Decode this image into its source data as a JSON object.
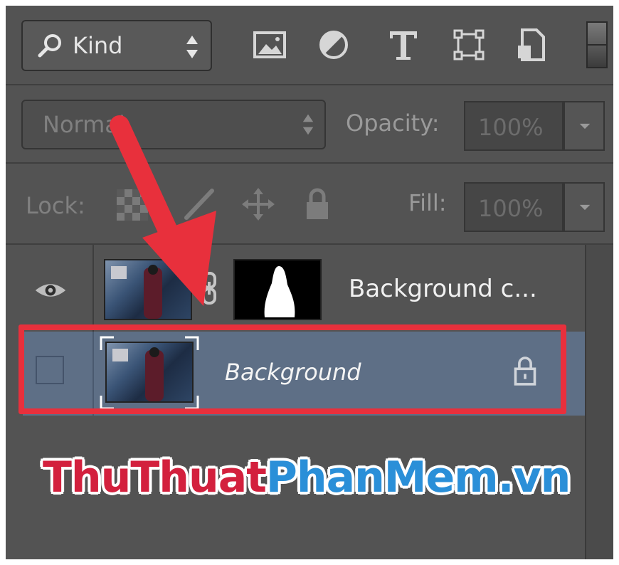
{
  "filter": {
    "kind_label": "Kind",
    "icons": [
      "image-filter-icon",
      "adjustment-filter-icon",
      "type-filter-icon",
      "shape-filter-icon",
      "smart-object-filter-icon",
      "filter-toggle-icon"
    ]
  },
  "blend": {
    "mode": "Normal",
    "opacity_label": "Opacity:",
    "opacity_value": "100%"
  },
  "lock": {
    "label": "Lock:",
    "fill_label": "Fill:",
    "fill_value": "100%"
  },
  "layers": [
    {
      "name": "Background c...",
      "visible": true,
      "has_mask": true,
      "locked": false,
      "selected": false
    },
    {
      "name": "Background",
      "visible": false,
      "has_mask": false,
      "locked": true,
      "selected": true
    }
  ],
  "watermark": {
    "part1": "ThuThuat",
    "part2": "PhanMem.vn"
  },
  "colors": {
    "panel_bg": "#535353",
    "selected_row": "#5e6f86",
    "annotation_red": "#e8303c",
    "watermark_red": "#d3203d",
    "watermark_blue": "#2a8fd8"
  }
}
